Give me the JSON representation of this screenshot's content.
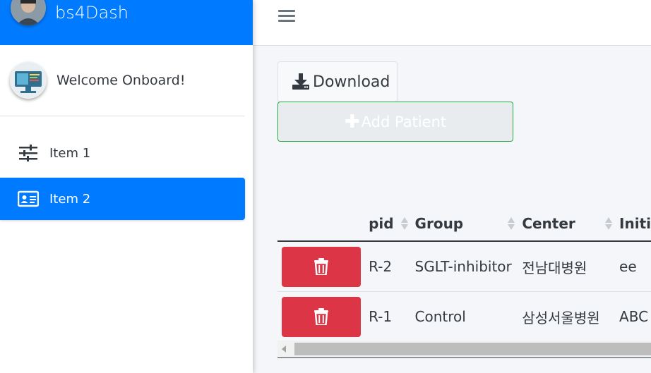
{
  "brand": {
    "name": "bs4Dash"
  },
  "user": {
    "name": "Welcome Onboard!"
  },
  "sidebar": {
    "items": [
      {
        "label": "Item 1",
        "icon": "sliders-icon",
        "active": false
      },
      {
        "label": "Item 2",
        "icon": "id-card-icon",
        "active": true
      }
    ]
  },
  "toolbar": {
    "download_label": "Download",
    "add_label": "Add Patient"
  },
  "table": {
    "headers": [
      "",
      "pid",
      "Group",
      "Center",
      "Initi"
    ],
    "rows": [
      {
        "pid": "R-2",
        "group": "SGLT-inhibitor",
        "center": "전남대병원",
        "initial": "ee"
      },
      {
        "pid": "R-1",
        "group": "Control",
        "center": "삼성서울병원",
        "initial": "ABC"
      }
    ]
  },
  "colors": {
    "primary": "#007bff",
    "danger": "#dc3545",
    "success_border": "#28a745"
  }
}
